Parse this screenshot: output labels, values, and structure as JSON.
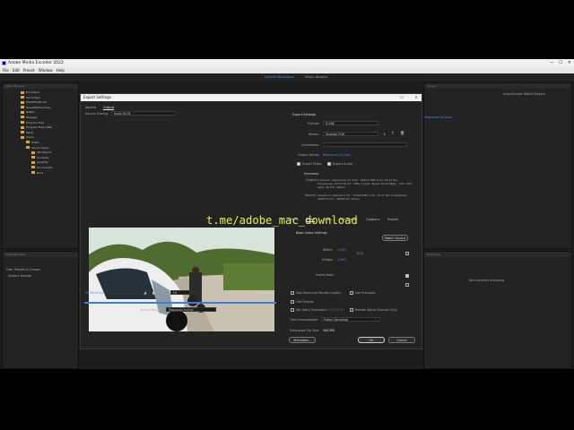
{
  "window": {
    "title": "Adobe Media Encoder 2022",
    "controls": [
      "—",
      "☐",
      "✕"
    ],
    "menus": [
      "File",
      "Edit",
      "Preset",
      "Window",
      "Help"
    ],
    "workspace_active": "Default Workspace",
    "workspace_other": "Media Browser"
  },
  "left_panel": {
    "title": "Media Browser",
    "folders": [
      "EX-Output",
      "Mx Output",
      "MORPHOSIS LD",
      "MovieMakServices",
      "Netflix",
      "Package",
      "Program Files",
      "Program Files (x86)",
      "Temp",
      "Users",
      "Public",
      "Kieran Vedan",
      "3D Objects",
      "Contacts",
      "Desktop",
      "Documents",
      "Book"
    ]
  },
  "bottom_left_panel": {
    "title": "Preset Browser",
    "sub": "User Presets & Groups",
    "item": "System Presets"
  },
  "right_panel": {
    "header_left": "Queue",
    "header_right": "Watch Folders",
    "file": "Sequence 01.mp4",
    "status_label": "Auto-Encode Watch Folders",
    "encoding": "Encoding",
    "encoding_status": "Not currently encoding"
  },
  "dialog": {
    "title": "Export Settings",
    "controls": [
      "☐",
      "✕"
    ],
    "tabs": [
      "Source",
      "Output"
    ],
    "source_scaling_label": "Source Scaling:",
    "source_scaling_value": "Scale To Fit",
    "timecode_in": "00;00;00;00",
    "timecode_out": "00;07;41;27",
    "fit_label": "Fit",
    "source_range_label": "Source Range:",
    "source_range_value": "Sequence In/Out",
    "export_settings_header": "Export Settings",
    "format_label": "Format:",
    "format_value": "H.264",
    "preset_label": "Preset:",
    "preset_value": "Youtube FHD",
    "comments_label": "Comments:",
    "output_name_label": "Output Name:",
    "output_name_value": "Sequence 01.mp4",
    "export_video_label": "Export Video",
    "export_audio_label": "Export Audio",
    "summary_header": "Summary",
    "output_summary_label": "Output:",
    "output_summary": "C:\\Users\\...\\Sequence 01.mp4 · 1920x1080 (1.0), 29.97 fps, Progressive, 00;07;41;27 · VBR, 1 pass, Target 16.00 Mbps · AAC, 320 kbps, 48 kHz, Stereo",
    "source_summary_label": "Source:",
    "source_summary": "Sequence, Sequence 01 · 1920x1080 (1.0), 29.97 fps, Progressive, 00;07;41;27 · 48000 Hz, Stereo",
    "effect_tabs": [
      "Effects",
      "Video",
      "Audio",
      "Multiplexer",
      "Captions",
      "Publish"
    ],
    "basic_video_header": "Basic Video Settings",
    "match_source_button": "Match Source",
    "width_label": "Width:",
    "width_value": "1,920",
    "height_label": "Height:",
    "height_value": "1,080",
    "frame_rate_label": "Frame Rate:",
    "use_max_render_label": "Use Maximum Render Quality",
    "use_previews_label": "Use Previews",
    "use_proxies_label": "Use Proxies",
    "set_start_tc_label": "Set Start Timecode",
    "set_start_tc_value": "00;00;00;00",
    "render_alpha_label": "Render Alpha Channel Only",
    "time_interp_label": "Time Interpolation:",
    "time_interp_value": "Frame Sampling",
    "file_size_label": "Estimated File Size:",
    "file_size_value": "946 MB",
    "metadata_button": "Metadata...",
    "ok_button": "OK",
    "cancel_button": "Cancel"
  },
  "watermark": "t.me/adobe_mac_download"
}
